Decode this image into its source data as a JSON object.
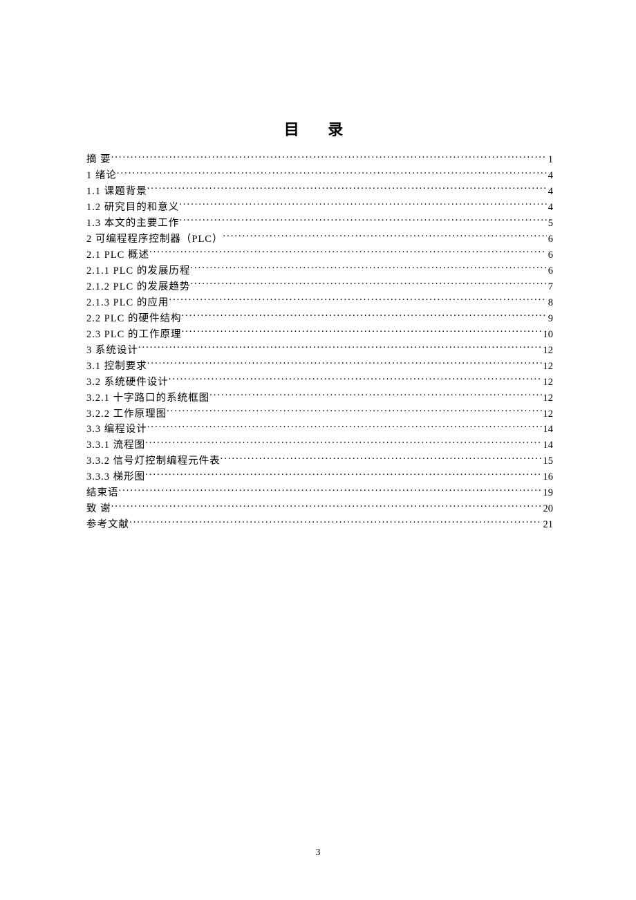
{
  "title": "目 录",
  "page_number": "3",
  "toc": [
    {
      "label": "摘   要 ",
      "page": "1"
    },
    {
      "label": "1 绪论 ",
      "page": "4"
    },
    {
      "label": "1.1 课题背景 ",
      "page": "4"
    },
    {
      "label": "1.2 研究目的和意义 ",
      "page": "4"
    },
    {
      "label": "1.3 本文的主要工作 ",
      "page": "5"
    },
    {
      "label": "2   可编程程序控制器（PLC） ",
      "page": "6"
    },
    {
      "label": "2.1 PLC 概述 ",
      "page": "6"
    },
    {
      "label": "2.1.1 PLC 的发展历程 ",
      "page": "6"
    },
    {
      "label": "2.1.2 PLC 的发展趋势 ",
      "page": "7"
    },
    {
      "label": "2.1.3 PLC 的应用 ",
      "page": "8"
    },
    {
      "label": "2.2  PLC 的硬件结构 ",
      "page": "9"
    },
    {
      "label": "2.3  PLC 的工作原理 ",
      "page": "10"
    },
    {
      "label": "3   系统设计 ",
      "page": "12"
    },
    {
      "label": "3.1 控制要求 ",
      "page": "12"
    },
    {
      "label": "3.2 系统硬件设计 ",
      "page": "12"
    },
    {
      "label": "3.2.1 十字路口的系统框图 ",
      "page": "12"
    },
    {
      "label": "3.2.2 工作原理图 ",
      "page": "12"
    },
    {
      "label": "3.3 编程设计 ",
      "page": "14"
    },
    {
      "label": "3.3.1 流程图 ",
      "page": "14"
    },
    {
      "label": "3.3.2 信号灯控制编程元件表 ",
      "page": "15"
    },
    {
      "label": "3.3.3 梯形图 ",
      "page": "16"
    },
    {
      "label": "结束语 ",
      "page": "19"
    },
    {
      "label": "致   谢 ",
      "page": "20"
    },
    {
      "label": "参考文献 ",
      "page": "21"
    }
  ]
}
